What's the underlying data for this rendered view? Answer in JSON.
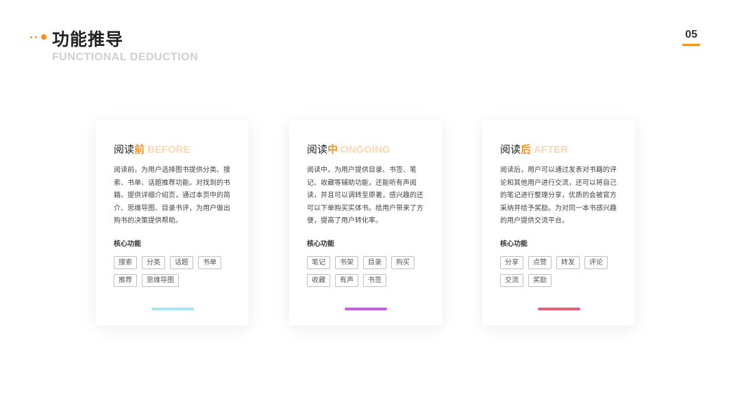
{
  "header": {
    "title": "功能推导",
    "subtitle": "FUNCTIONAL DEDUCTION",
    "page_number": "05",
    "accent_color": "#f6901e"
  },
  "cards": [
    {
      "title_prefix": "阅读",
      "title_highlight": "前",
      "title_en": "BEFORE",
      "description": "阅读前，为用户选择图书提供分类、搜索、书单、话题推荐功能。对找到的书籍。提供详细介绍页，通过本页中的简介、思维导图、目录书评，为用户做出购书的决策提供帮助。",
      "core_label": "核心功能",
      "tags": [
        "搜索",
        "分类",
        "话题",
        "书单",
        "推荐",
        "思维导图"
      ],
      "accent_color": "#a6e8f1"
    },
    {
      "title_prefix": "阅读",
      "title_highlight": "中",
      "title_en": "ONGOING",
      "description": "阅读中，为用户提供目录、书签、笔记、收藏等辅助功能，还能听有声阅读，并且可以调转至原著，感兴趣的还可以下单购买实体书。给用户带来了方便，提高了用户转化率。",
      "core_label": "核心功能",
      "tags": [
        "笔记",
        "书架",
        "目录",
        "购买",
        "收藏",
        "有声",
        "书签"
      ],
      "accent_color": "#c45ee6"
    },
    {
      "title_prefix": "阅读",
      "title_highlight": "后",
      "title_en": "AFTER",
      "description": "阅读后，用户可以通过发表对书籍的评论和其他用户进行交流，还可以将自己的笔记进行整理分享，优质的会被官方采纳并给予奖励。为对同一本书感兴趣的用户提供交流平台。",
      "core_label": "核心功能",
      "tags": [
        "分享",
        "点赞",
        "转发",
        "评论",
        "交流",
        "奖励"
      ],
      "accent_color": "#ec5a78"
    }
  ]
}
